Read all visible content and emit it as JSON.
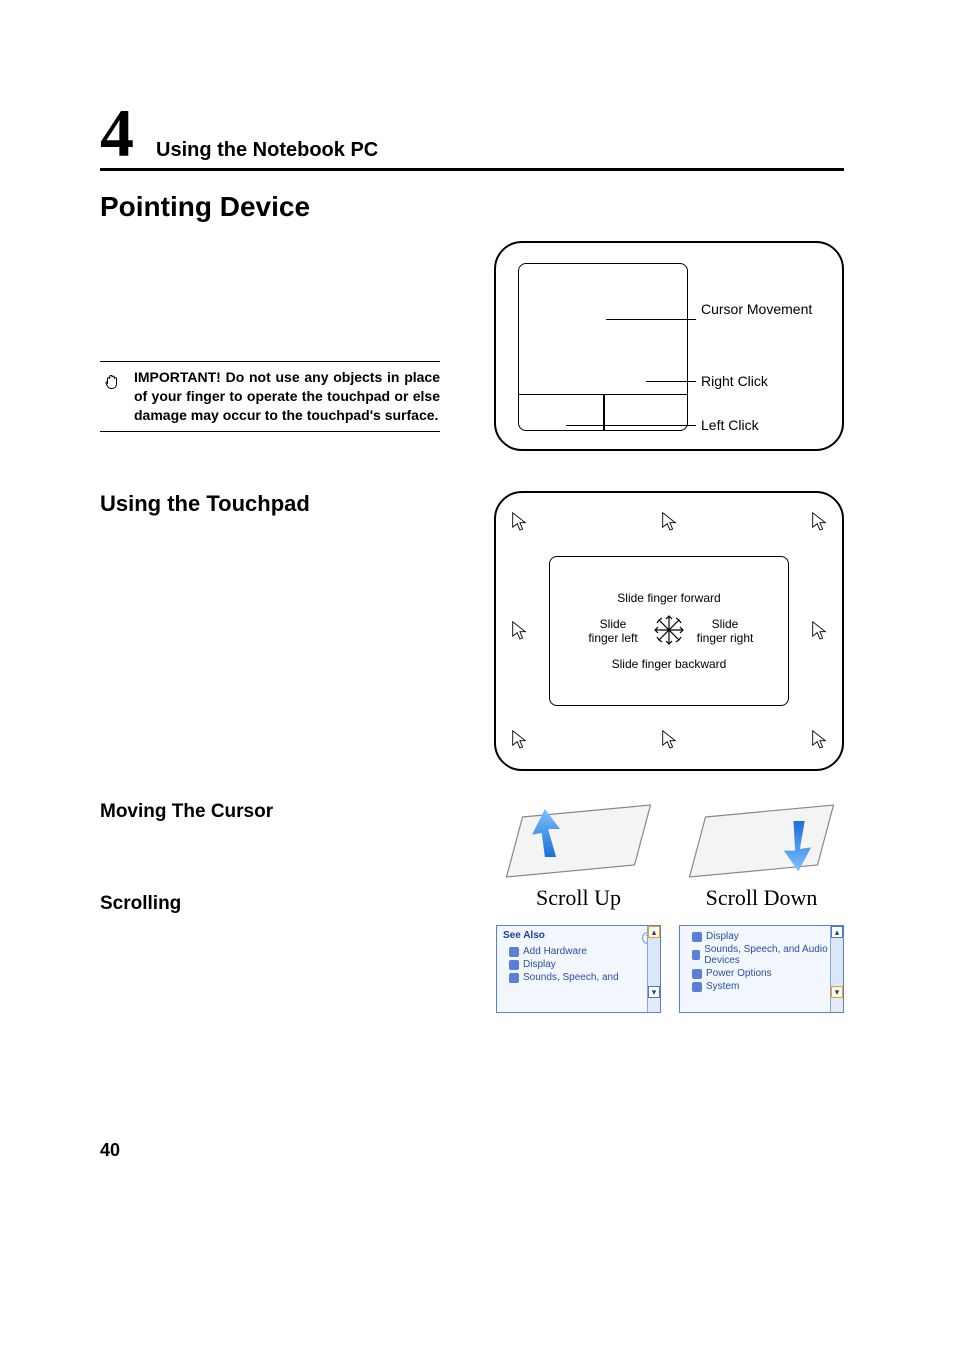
{
  "header": {
    "chapter_number": "4",
    "chapter_title": "Using the Notebook PC"
  },
  "title": "Pointing Device",
  "note": {
    "text": "IMPORTANT! Do not use any objects in place of your finger to operate the touchpad or else damage may occur to the touchpad's surface."
  },
  "diagram1": {
    "cursor_movement": "Cursor Movement",
    "right_click": "Right Click",
    "left_click": "Left Click"
  },
  "h2_using": "Using the Touchpad",
  "diagram2": {
    "forward": "Slide finger forward",
    "backward": "Slide finger backward",
    "left": "Slide finger left",
    "right": "Slide finger right"
  },
  "h3_moving": "Moving The Cursor",
  "h3_scrolling": "Scrolling",
  "scroll": {
    "up": "Scroll Up",
    "down": "Scroll Down"
  },
  "panel_up": {
    "title": "See Also",
    "items": [
      "Add Hardware",
      "Display",
      "Sounds, Speech, and"
    ]
  },
  "panel_down": {
    "items": [
      "Display",
      "Sounds, Speech, and Audio Devices",
      "Power Options",
      "System"
    ]
  },
  "page_number": "40"
}
